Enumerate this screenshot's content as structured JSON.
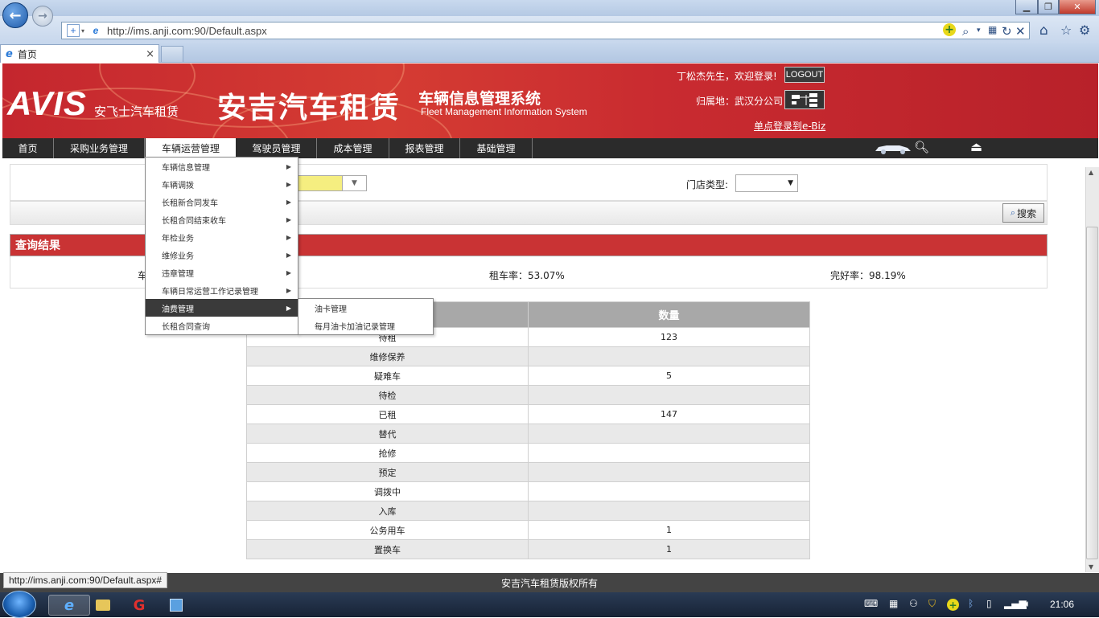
{
  "browser": {
    "url": "http://ims.anji.com:90/Default.aspx",
    "tab_title": "首页",
    "tab_close": "×",
    "status_url": "http://ims.anji.com:90/Default.aspx#"
  },
  "header": {
    "brand": "AVIS",
    "brand_sub": "安飞士汽车租赁",
    "company": "安吉汽车租赁",
    "system_cn": "车辆信息管理系统",
    "system_en": "Fleet Management Information System",
    "welcome": "丁松杰先生，欢迎登录!",
    "logout": "LOGOUT",
    "location": "归属地：武汉分公司",
    "sso": "单点登录到e-Biz"
  },
  "menu": [
    {
      "label": "首页"
    },
    {
      "label": "采购业务管理"
    },
    {
      "label": "车辆运营管理"
    },
    {
      "label": "驾驶员管理"
    },
    {
      "label": "成本管理"
    },
    {
      "label": "报表管理"
    },
    {
      "label": "基础管理"
    }
  ],
  "dropdown": [
    {
      "label": "车辆信息管理",
      "has_sub": true
    },
    {
      "label": "车辆调拨",
      "has_sub": true
    },
    {
      "label": "长租新合同发车",
      "has_sub": true
    },
    {
      "label": "长租合同结束收车",
      "has_sub": true
    },
    {
      "label": "年检业务",
      "has_sub": true
    },
    {
      "label": "维修业务",
      "has_sub": true
    },
    {
      "label": "违章管理",
      "has_sub": true
    },
    {
      "label": "车辆日常运营工作记录管理",
      "has_sub": true
    },
    {
      "label": "油费管理",
      "has_sub": true
    },
    {
      "label": "长租合同查询",
      "has_sub": false
    }
  ],
  "submenu": [
    {
      "label": "油卡管理"
    },
    {
      "label": "每月油卡加油记录管理"
    }
  ],
  "filters": {
    "store_type_label": "门店类型:",
    "store_type_value": ""
  },
  "search_button": "搜索",
  "results": {
    "title": "查询结果",
    "partial_label": "车",
    "rental_rate": "租车率：53.07%",
    "good_rate": "完好率：98.19%"
  },
  "table": {
    "header_qty": "数量",
    "rows": [
      {
        "status": "待租",
        "qty": "123"
      },
      {
        "status": "维修保养",
        "qty": ""
      },
      {
        "status": "疑难车",
        "qty": "5"
      },
      {
        "status": "待检",
        "qty": ""
      },
      {
        "status": "已租",
        "qty": "147"
      },
      {
        "status": "替代",
        "qty": ""
      },
      {
        "status": "抢修",
        "qty": ""
      },
      {
        "status": "预定",
        "qty": ""
      },
      {
        "status": "调拨中",
        "qty": ""
      },
      {
        "status": "入库",
        "qty": ""
      },
      {
        "status": "公务用车",
        "qty": "1"
      },
      {
        "status": "置换车",
        "qty": "1"
      }
    ]
  },
  "footer": "安吉汽车租赁版权所有",
  "taskbar": {
    "clock": "21:06"
  },
  "colors": {
    "header_red": "#c92b30",
    "menu_dark": "#2b2b2b",
    "result_bar": "#c93334"
  }
}
